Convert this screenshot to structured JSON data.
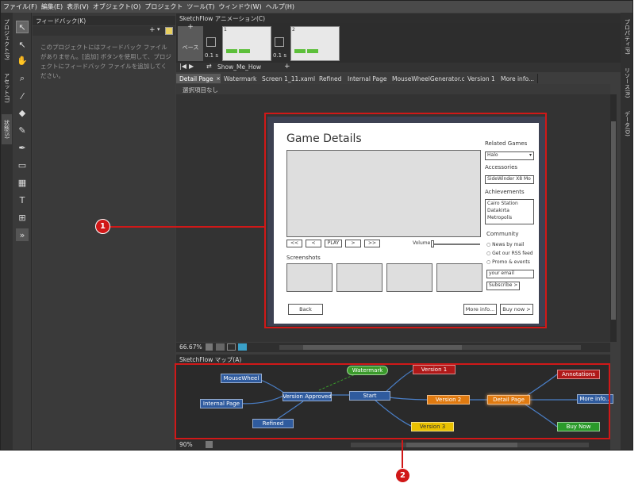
{
  "menu": [
    "ファイル(F)",
    "編集(E)",
    "表示(V)",
    "オブジェクト(O)",
    "プロジェクト",
    "ツール(T)",
    "ウィンドウ(W)",
    "ヘルプ(H)"
  ],
  "left_tabs": [
    "プロジェクト(P)",
    "アセット(T)",
    "状態(S)"
  ],
  "right_tabs": [
    "プロパティ(P)",
    "リソース(R)",
    "データ(D)"
  ],
  "feedback": {
    "title": "フィードバック(K)",
    "body": "このプロジェクトにはフィードバック ファイルがありません。[追加] ボタンを使用して、プロジェクトにフィードバック ファイルを追加してください。"
  },
  "animation": {
    "title": "SketchFlow アニメーション(C)",
    "base_label": "ベース",
    "frame1_num": "1",
    "frame2_num": "2",
    "duration1": "0.1 s",
    "duration2": "0.1 s",
    "name": "Show_Me_How"
  },
  "doc_tabs": [
    "Detail Page",
    "Watermark",
    "Screen 1_11.xaml",
    "Refined",
    "Internal Page",
    "MouseWheelGenerator.cs",
    "Version 1",
    "More info..."
  ],
  "no_selection": "選択項目なし",
  "zoom": "66.67%",
  "mock": {
    "title": "Game Details",
    "related_games_label": "Related Games",
    "related_games_value": "Halo",
    "accessories_label": "Accessories",
    "accessories_value": "SideWinder X8 Mo",
    "achievements_label": "Achievements",
    "achievements": [
      "Cairo Station",
      "Datakirta",
      "Metropolis"
    ],
    "community_label": "Community",
    "community_options": [
      "News by mail",
      "Get our RSS feed",
      "Promo & events"
    ],
    "email_placeholder": "your email",
    "subscribe": "Subscribe >",
    "player_buttons": [
      "<<",
      "<",
      "PLAY",
      ">",
      ">>"
    ],
    "volume": "Volume",
    "screenshots_label": "Screenshots",
    "back": "Back",
    "more_info": "More info...",
    "buy_now": "Buy now >"
  },
  "map": {
    "title": "SketchFlow マップ(A)",
    "zoom": "90%",
    "nodes": [
      {
        "label": "MouseWheel",
        "color": "#2f5b9e"
      },
      {
        "label": "Internal Page",
        "color": "#2f5b9e"
      },
      {
        "label": "Version Approved",
        "color": "#2f5b9e"
      },
      {
        "label": "Refined",
        "color": "#2f5b9e"
      },
      {
        "label": "Watermark",
        "color": "#3a9a2a"
      },
      {
        "label": "Start",
        "color": "#2f5b9e"
      },
      {
        "label": "Version 1",
        "color": "#b01818"
      },
      {
        "label": "Version 2",
        "color": "#e07a10"
      },
      {
        "label": "Version 3",
        "color": "#e8c000"
      },
      {
        "label": "Detail Page",
        "color": "#e07a10"
      },
      {
        "label": "Annotations",
        "color": "#b01818"
      },
      {
        "label": "More info...",
        "color": "#2f5b9e"
      },
      {
        "label": "Buy Now",
        "color": "#2a9a2a"
      }
    ]
  },
  "callouts": [
    "1",
    "2"
  ],
  "colors": {
    "callout_red": "#d01818"
  }
}
